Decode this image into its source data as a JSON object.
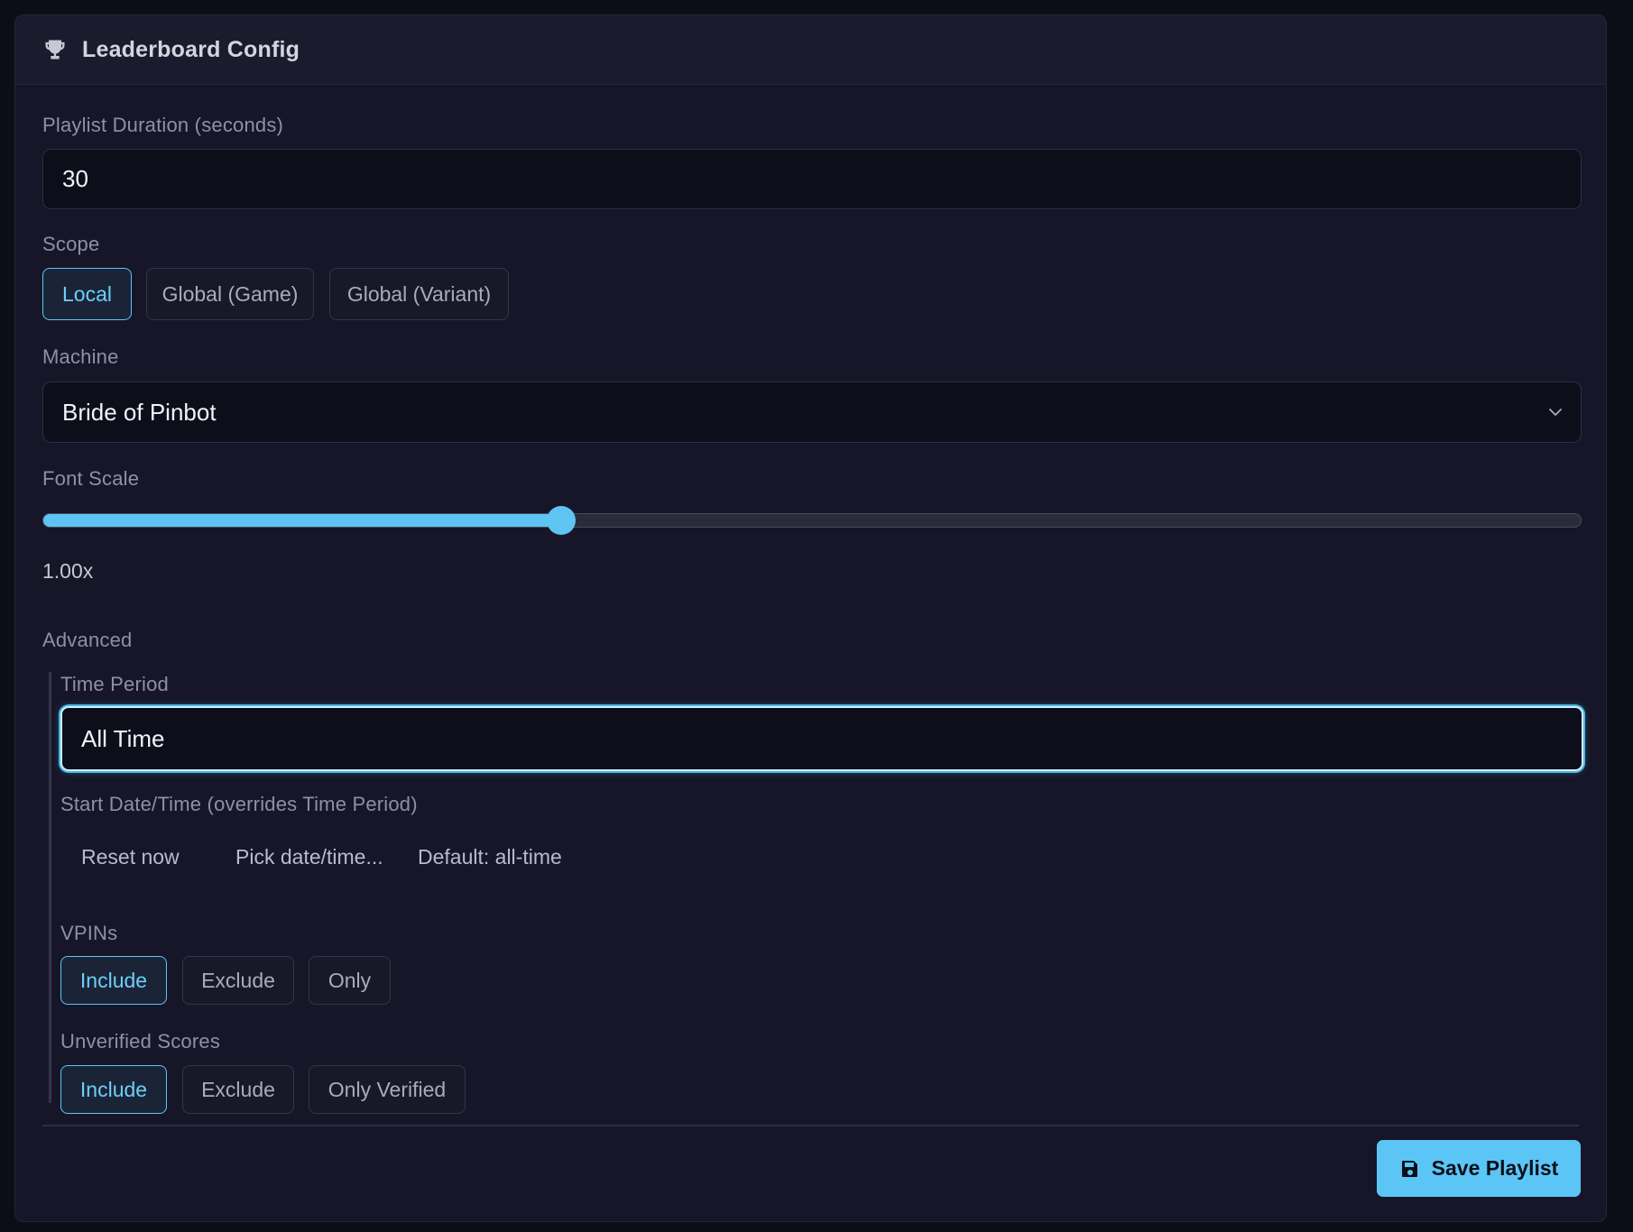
{
  "header": {
    "icon": "trophy-icon",
    "title": "Leaderboard Config"
  },
  "playlist_duration": {
    "label": "Playlist Duration (seconds)",
    "value": "30"
  },
  "scope": {
    "label": "Scope",
    "options": [
      "Local",
      "Global (Game)",
      "Global (Variant)"
    ],
    "selected": "Local"
  },
  "machine": {
    "label": "Machine",
    "value": "Bride of Pinbot",
    "icon": "chevron-down-icon"
  },
  "font_scale": {
    "label": "Font Scale",
    "value_text": "1.00x",
    "fill_fraction": 0.337
  },
  "advanced": {
    "label": "Advanced",
    "time_period": {
      "label": "Time Period",
      "value": "All Time"
    },
    "start_datetime": {
      "label": "Start Date/Time (overrides Time Period)",
      "reset_label": "Reset now",
      "pick_label": "Pick date/time...",
      "default_text": "Default: all-time"
    },
    "vpins": {
      "label": "VPINs",
      "options": [
        "Include",
        "Exclude",
        "Only"
      ],
      "selected": "Include"
    },
    "unverified": {
      "label": "Unverified Scores",
      "options": [
        "Include",
        "Exclude",
        "Only Verified"
      ],
      "selected": "Include"
    }
  },
  "footer": {
    "save_label": "Save Playlist",
    "save_icon": "save-disk-icon"
  },
  "colors": {
    "accent": "#5bc6f5",
    "background": "#161628",
    "field_background": "#0e0e1b"
  }
}
